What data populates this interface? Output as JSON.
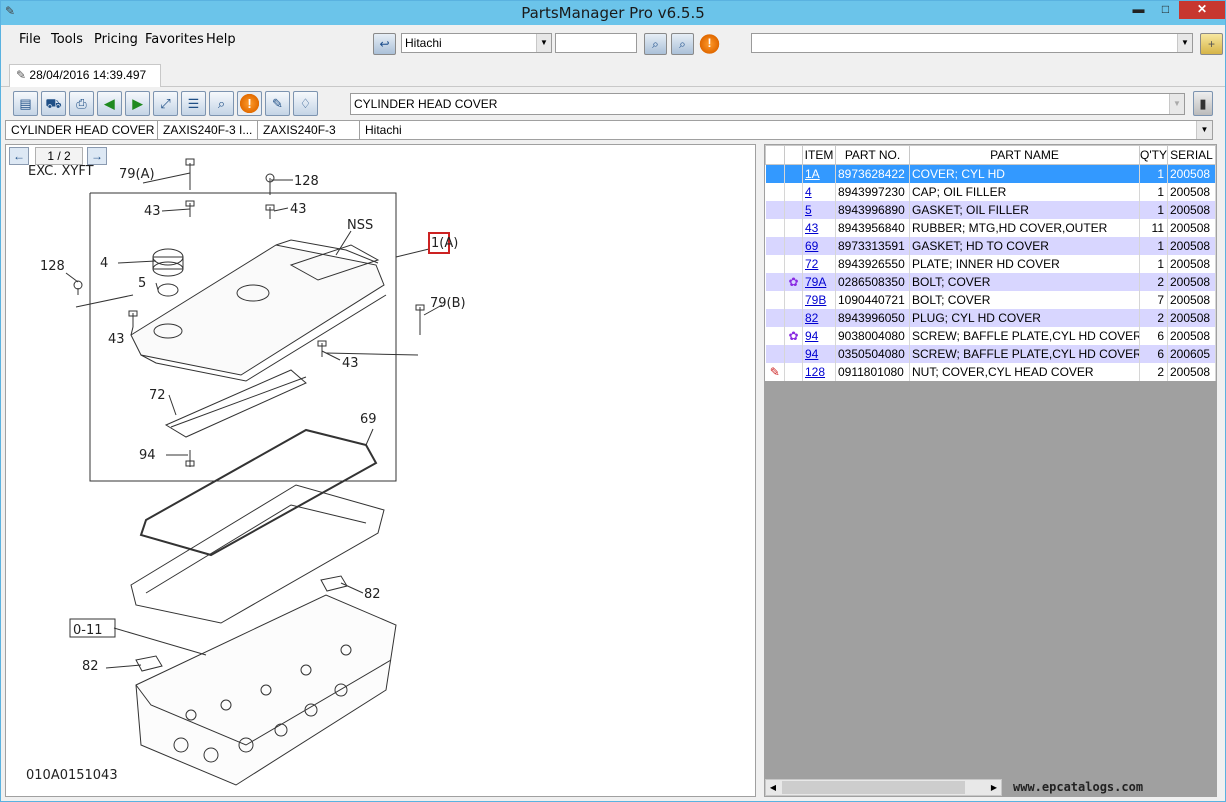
{
  "window": {
    "title": "PartsManager Pro v6.5.5",
    "minimize_glyph": "▬",
    "maximize_glyph": "□",
    "close_glyph": "✕"
  },
  "menu": {
    "items": [
      "File",
      "Tools",
      "Pricing",
      "Favorites",
      "Help"
    ],
    "brand_select": "Hitachi",
    "search_value": "",
    "right_select": ""
  },
  "tab": {
    "label": "28/04/2016 14:39.497"
  },
  "toolbar": {
    "page_title": "CYLINDER HEAD COVER",
    "icons": [
      "catalog-icon",
      "truck-icon",
      "print-icon",
      "back-icon",
      "forward-icon",
      "fit-screen-icon",
      "list-view-icon",
      "zoom-icon",
      "warning-icon",
      "settings-icon",
      "tip-icon"
    ]
  },
  "breadcrumb": [
    "CYLINDER HEAD COVER",
    "ZAXIS240F-3 I...",
    "ZAXIS240F-3",
    "Hitachi"
  ],
  "pager": {
    "label": "1 / 2"
  },
  "diagram": {
    "header_text": "EXC. XYFT",
    "figure_id": "010A0151043",
    "callouts": [
      "79(A)",
      "128",
      "43",
      "43",
      "NSS",
      "1(A)",
      "4",
      "5",
      "128",
      "79(B)",
      "43",
      "43",
      "72",
      "94",
      "69",
      "82",
      "0-11",
      "82"
    ]
  },
  "parts_table": {
    "columns": [
      "ITEM",
      "PART NO.",
      "PART NAME",
      "Q'TY",
      "SERIAL"
    ],
    "rows": [
      {
        "mark": "",
        "item": "1A",
        "part_no": "8973628422",
        "name": "COVER; CYL HD",
        "qty": "1",
        "serial": "200508",
        "style": "selected"
      },
      {
        "mark": "",
        "item": "4",
        "part_no": "8943997230",
        "name": "CAP; OIL FILLER",
        "qty": "1",
        "serial": "200508",
        "style": ""
      },
      {
        "mark": "",
        "item": "5",
        "part_no": "8943996890",
        "name": "GASKET; OIL FILLER",
        "qty": "1",
        "serial": "200508",
        "style": "alt"
      },
      {
        "mark": "",
        "item": "43",
        "part_no": "8943956840",
        "name": "RUBBER; MTG,HD COVER,OUTER",
        "qty": "11",
        "serial": "200508",
        "style": ""
      },
      {
        "mark": "",
        "item": "69",
        "part_no": "8973313591",
        "name": "GASKET; HD TO COVER",
        "qty": "1",
        "serial": "200508",
        "style": "alt"
      },
      {
        "mark": "",
        "item": "72",
        "part_no": "8943926550",
        "name": "PLATE; INNER HD COVER",
        "qty": "1",
        "serial": "200508",
        "style": ""
      },
      {
        "mark": "gear-icon",
        "item": "79A",
        "part_no": "0286508350",
        "name": "BOLT; COVER",
        "qty": "2",
        "serial": "200508",
        "style": "alt"
      },
      {
        "mark": "",
        "item": "79B",
        "part_no": "1090440721",
        "name": "BOLT; COVER",
        "qty": "7",
        "serial": "200508",
        "style": ""
      },
      {
        "mark": "",
        "item": "82",
        "part_no": "8943996050",
        "name": "PLUG; CYL HD COVER",
        "qty": "2",
        "serial": "200508",
        "style": "alt"
      },
      {
        "mark": "gear-icon",
        "item": "94",
        "part_no": "9038004080",
        "name": "SCREW; BAFFLE PLATE,CYL HD COVER",
        "qty": "6",
        "serial": "200508",
        "style": ""
      },
      {
        "mark": "",
        "item": "94",
        "part_no": "0350504080",
        "name": "SCREW; BAFFLE PLATE,CYL HD COVER",
        "qty": "6",
        "serial": "200605",
        "style": "alt"
      },
      {
        "mark": "note-icon",
        "item": "128",
        "part_no": "0911801080",
        "name": "NUT; COVER,CYL HEAD COVER",
        "qty": "2",
        "serial": "200508",
        "style": ""
      }
    ]
  },
  "watermark": "www.epcatalogs.com",
  "colors": {
    "titlebar": "#6bc4ea",
    "selected_row": "#3399ff",
    "alt_row": "#d8d6ff",
    "link": "#0000d0"
  }
}
